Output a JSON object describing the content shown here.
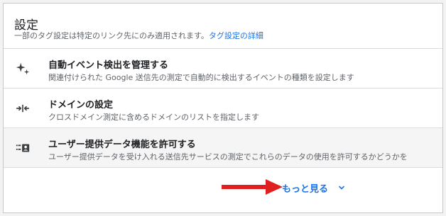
{
  "header": {
    "title": "設定",
    "description": "一部のタグ設定は特定のリンク先にのみ適用されます。",
    "link": "タグ設定の詳細"
  },
  "rows": [
    {
      "title": "自動イベント検出を管理する",
      "description": "関連付けられた Google 送信先の測定で自動的に検出するイベントの種類を設定します",
      "icon": "sparkle-icon"
    },
    {
      "title": "ドメインの設定",
      "description": "クロスドメイン測定に含めるドメインのリストを指定します",
      "icon": "merge-arrows-icon"
    },
    {
      "title": "ユーザー提供データ機能を許可する",
      "description": "ユーザー提供データを受け入れる送信先サービスの測定でこれらのデータの使用を許可するかどうかを",
      "icon": "user-data-icon"
    }
  ],
  "more": {
    "label": "もっと見る",
    "icon": "chevron-down-icon"
  },
  "colors": {
    "accent": "#1a73e8",
    "annotation_arrow": "#e02020",
    "text_primary": "#202124",
    "text_secondary": "#5f6368"
  }
}
